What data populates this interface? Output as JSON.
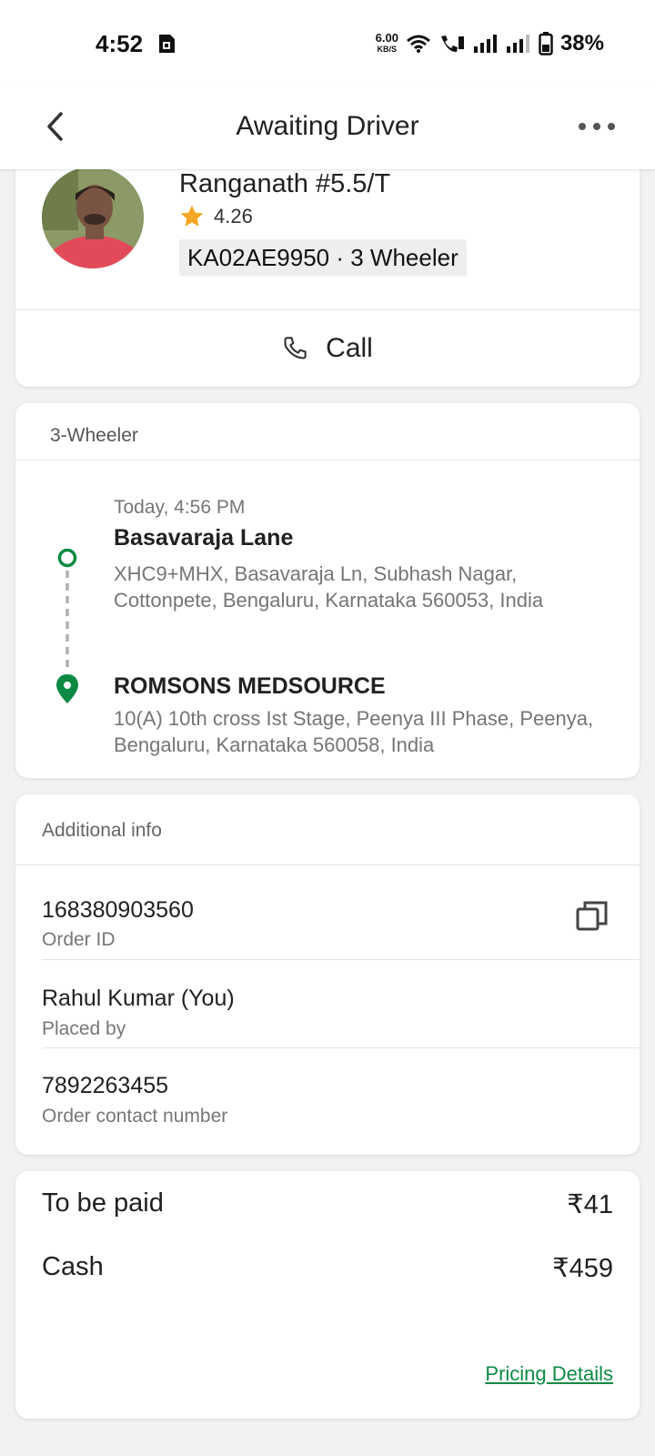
{
  "status_bar": {
    "time": "4:52",
    "net_speed_value": "6.00",
    "net_speed_unit": "KB/S",
    "battery": "38%"
  },
  "header": {
    "title": "Awaiting Driver"
  },
  "driver": {
    "name": "Ranganath #5.5/T",
    "rating": "4.26",
    "vehicle": "KA02AE9950 · 3 Wheeler",
    "call_label": "Call"
  },
  "trip": {
    "vehicle_type": "3-Wheeler",
    "pickup": {
      "time": "Today, 4:56 PM",
      "name": "Basavaraja Lane",
      "address": "XHC9+MHX, Basavaraja Ln, Subhash Nagar, Cottonpete, Bengaluru, Karnataka 560053, India"
    },
    "drop": {
      "name": "ROMSONS MEDSOURCE",
      "address": "10(A) 10th cross Ist Stage, Peenya III Phase, Peenya, Bengaluru, Karnataka 560058, India"
    }
  },
  "additional_info": {
    "title": "Additional info",
    "rows": [
      {
        "value": "168380903560",
        "label": "Order ID"
      },
      {
        "value": "Rahul Kumar (You)",
        "label": "Placed by"
      },
      {
        "value": "7892263455",
        "label": "Order contact number"
      }
    ]
  },
  "payment": {
    "to_be_paid_label": "To be paid",
    "to_be_paid_amount": "₹41",
    "cash_label": "Cash",
    "cash_amount": "₹459",
    "pricing_link": "Pricing Details"
  },
  "colors": {
    "accent_green": "#0c8a43",
    "star": "#f5a623"
  },
  "icons": {
    "back": "back-arrow-icon",
    "more": "more-dots-icon",
    "star": "star-icon",
    "phone": "phone-icon",
    "copy": "copy-icon",
    "pickup": "pickup-dot-icon",
    "drop": "drop-pin-icon"
  }
}
